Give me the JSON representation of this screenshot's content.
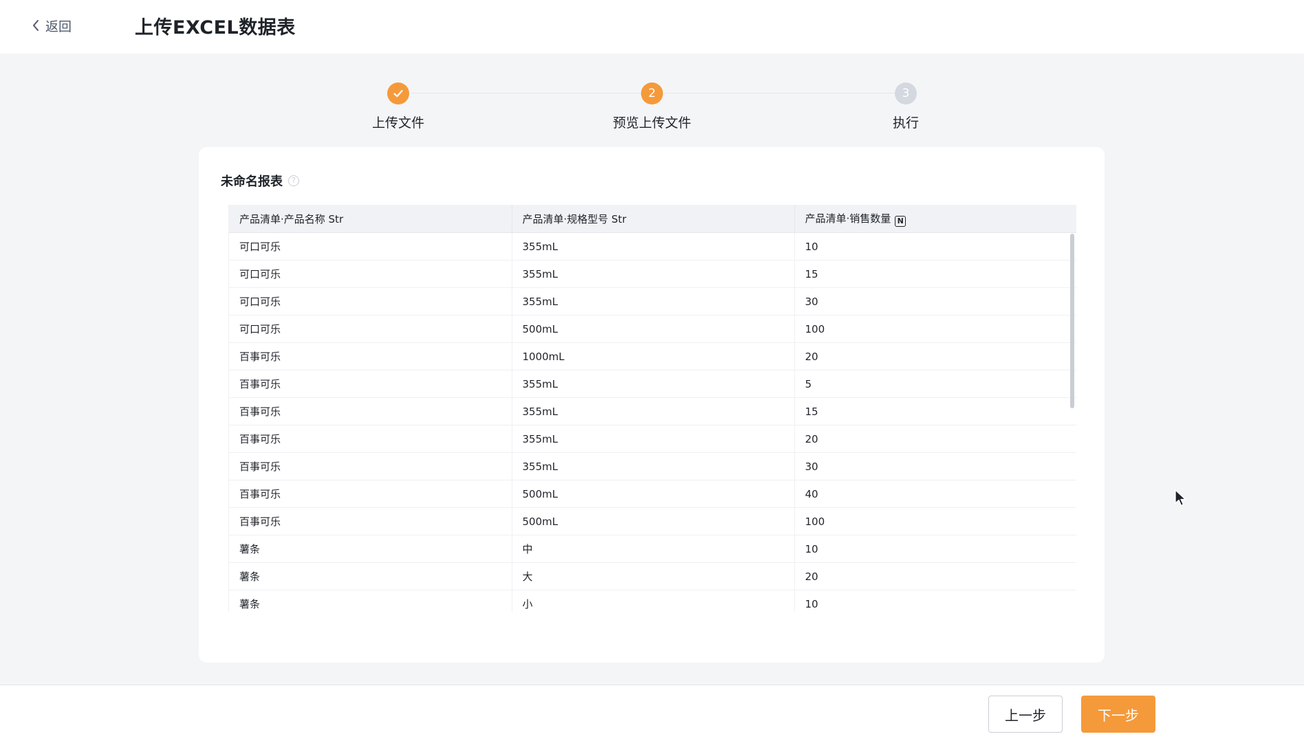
{
  "header": {
    "back_label": "返回",
    "title": "上传EXCEL数据表"
  },
  "stepper": {
    "steps": [
      {
        "label": "上传文件",
        "state": "done",
        "number": "1"
      },
      {
        "label": "预览上传文件",
        "state": "active",
        "number": "2"
      },
      {
        "label": "执行",
        "state": "pending",
        "number": "3"
      }
    ]
  },
  "report": {
    "title": "未命名报表",
    "help_icon": "question-circle-icon"
  },
  "table": {
    "columns": [
      {
        "label": "产品清单·产品名称 Str",
        "badge": ""
      },
      {
        "label": "产品清单·规格型号 Str",
        "badge": ""
      },
      {
        "label": "产品清单·销售数量",
        "badge": "N"
      }
    ],
    "rows": [
      [
        "可口可乐",
        "355mL",
        "10"
      ],
      [
        "可口可乐",
        "355mL",
        "15"
      ],
      [
        "可口可乐",
        "355mL",
        "30"
      ],
      [
        "可口可乐",
        "500mL",
        "100"
      ],
      [
        "百事可乐",
        "1000mL",
        "20"
      ],
      [
        "百事可乐",
        "355mL",
        "5"
      ],
      [
        "百事可乐",
        "355mL",
        "15"
      ],
      [
        "百事可乐",
        "355mL",
        "20"
      ],
      [
        "百事可乐",
        "355mL",
        "30"
      ],
      [
        "百事可乐",
        "500mL",
        "40"
      ],
      [
        "百事可乐",
        "500mL",
        "100"
      ],
      [
        "薯条",
        "中",
        "10"
      ],
      [
        "薯条",
        "大",
        "20"
      ],
      [
        "薯条",
        "小",
        "10"
      ]
    ]
  },
  "footer": {
    "prev_label": "上一步",
    "next_label": "下一步"
  },
  "colors": {
    "accent": "#f59a3b",
    "pending": "#d4d8e0"
  }
}
